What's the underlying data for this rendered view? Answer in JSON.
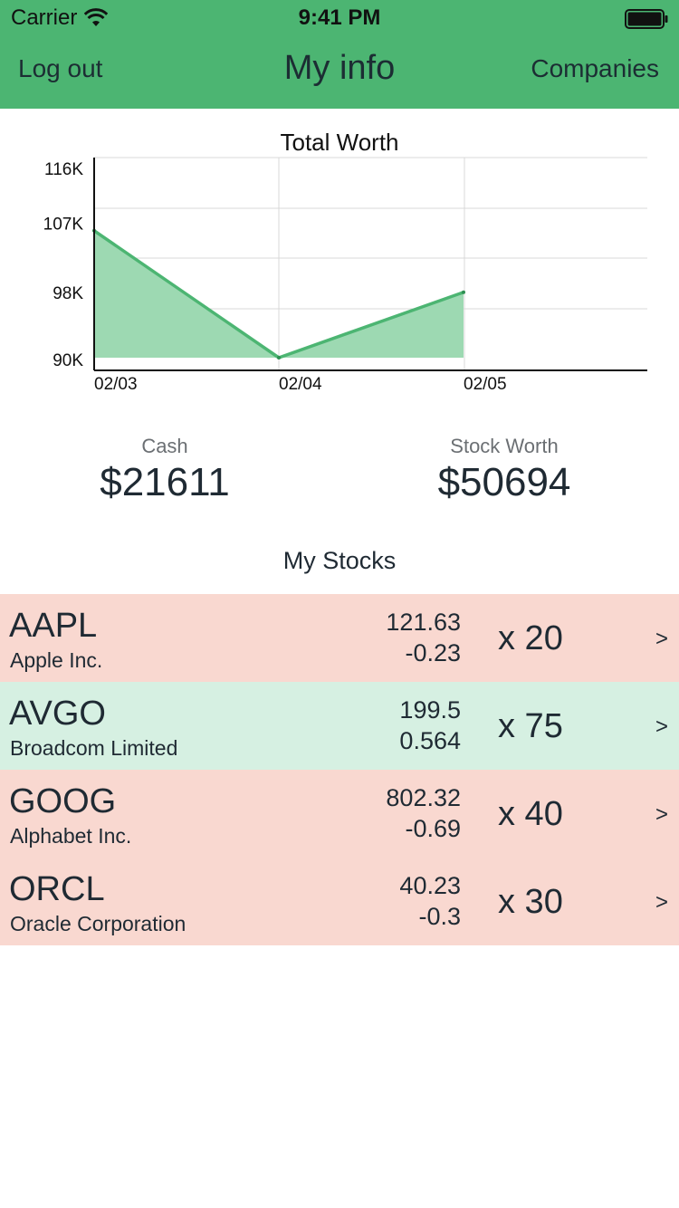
{
  "status_bar": {
    "carrier": "Carrier",
    "time": "9:41 PM",
    "icons": [
      "wifi-icon",
      "battery-icon"
    ]
  },
  "nav": {
    "left_label": "Log out",
    "title": "My info",
    "right_label": "Companies",
    "background": "#4cb572"
  },
  "chart_data": {
    "type": "area",
    "title": "Total Worth",
    "xlabel": "",
    "ylabel": "",
    "x": [
      "02/03",
      "02/04",
      "02/05"
    ],
    "x_ticks": [
      "02/03",
      "02/04",
      "02/05"
    ],
    "y_ticks": [
      "116K",
      "107K",
      "98K",
      "90K"
    ],
    "y_tick_values": [
      116000,
      107000,
      98000,
      90000
    ],
    "ylim": [
      90000,
      116000
    ],
    "grid": true,
    "series": [
      {
        "values": [
          106500,
          90000,
          98500
        ],
        "color": "#4cb572",
        "fill": "#9dd9b2"
      }
    ]
  },
  "summary": {
    "cash_label": "Cash",
    "cash_value": "$21611",
    "stock_label": "Stock Worth",
    "stock_value": "$50694"
  },
  "section_title": "My Stocks",
  "stocks": [
    {
      "ticker": "AAPL",
      "company": "Apple Inc.",
      "price": "121.63",
      "change": "-0.23",
      "qty": "x 20",
      "trend": "down"
    },
    {
      "ticker": "AVGO",
      "company": "Broadcom Limited",
      "price": "199.5",
      "change": "0.564",
      "qty": "x 75",
      "trend": "up"
    },
    {
      "ticker": "GOOG",
      "company": "Alphabet Inc.",
      "price": "802.32",
      "change": "-0.69",
      "qty": "x 40",
      "trend": "down"
    },
    {
      "ticker": "ORCL",
      "company": "Oracle Corporation",
      "price": "40.23",
      "change": "-0.3",
      "qty": "x 30",
      "trend": "down"
    }
  ],
  "colors": {
    "down_row": "#f9d8d0",
    "up_row": "#d6f0e2"
  }
}
